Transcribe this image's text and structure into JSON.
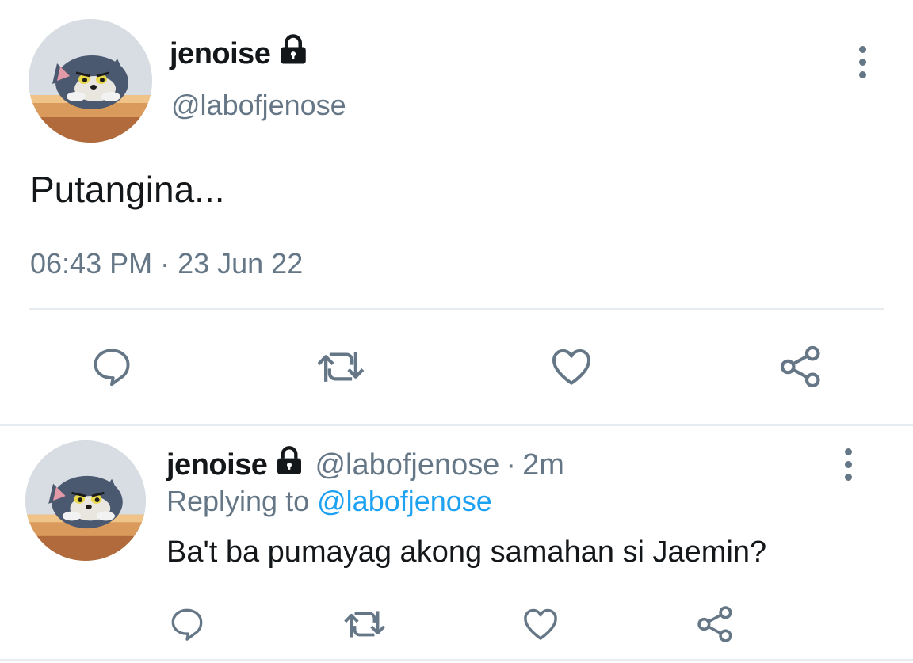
{
  "main_tweet": {
    "display_name": "jenoise",
    "handle": "@labofjenose",
    "text": "Putangina...",
    "timestamp": "06:43 PM · 23 Jun 22",
    "protected_icon": "lock-icon",
    "actions": [
      "reply-icon",
      "retweet-icon",
      "like-icon",
      "share-icon"
    ]
  },
  "reply_tweet": {
    "display_name": "jenoise",
    "handle": "@labofjenose",
    "separator": "·",
    "age": "2m",
    "replying_prefix": "Replying to",
    "replying_handle": "@labofjenose",
    "text": "Ba't ba pumayag akong samahan si Jaemin?",
    "protected_icon": "lock-icon",
    "actions": [
      "reply-icon",
      "retweet-icon",
      "like-icon",
      "share-icon"
    ]
  },
  "colors": {
    "text": "#14171a",
    "secondary": "#657786",
    "link": "#1da1f2",
    "divider": "#e6ecf0",
    "icon": "#657786"
  }
}
